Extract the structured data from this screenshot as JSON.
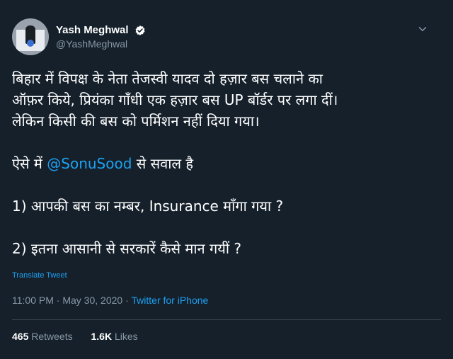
{
  "author": {
    "display_name": "Yash Meghwal",
    "handle": "@YashMeghwal",
    "verified_icon": "verified-badge-icon"
  },
  "tweet": {
    "paragraph_1": [
      "बिहार में विपक्ष के नेता तेजस्वी यादव दो हज़ार बस चलाने का",
      "ऑफ़र किये, प्रियंका गाँधी एक हज़ार बस UP बॉर्डर पर लगा दीं।",
      "लेकिन किसी की बस को पर्मिशन नहीं दिया गया।"
    ],
    "line_before_mention": "ऐसे में ",
    "mention": "@SonuSood",
    "line_after_mention": " से सवाल है",
    "question_1": "1) आपकी बस का नम्बर, Insurance माँगा गया ?",
    "question_2": "2) इतना आसानी से सरकारें कैसे मान गयीं ?"
  },
  "translate_label": "Translate Tweet",
  "meta": {
    "time": "11:00 PM",
    "separator_1": " · ",
    "date": "May 30, 2020",
    "separator_2": " · ",
    "source": "Twitter for iPhone"
  },
  "stats": {
    "retweets_count": "465",
    "retweets_label": "Retweets",
    "likes_count": "1.6K",
    "likes_label": "Likes"
  },
  "colors": {
    "background": "#15202b",
    "accent": "#1da1f2",
    "secondary_text": "#8899a6"
  }
}
